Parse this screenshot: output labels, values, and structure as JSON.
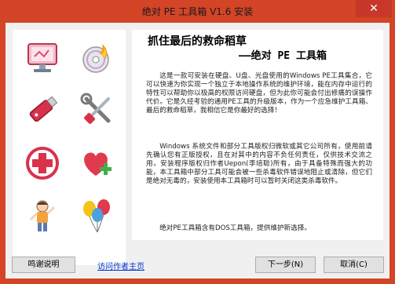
{
  "window": {
    "title": "绝对 PE 工具箱 V1.6 安装",
    "close_glyph": "✕"
  },
  "left_icons": [
    {
      "name": "computer-icon"
    },
    {
      "name": "disc-icon"
    },
    {
      "name": "usb-drive-icon"
    },
    {
      "name": "tools-icon"
    },
    {
      "name": "first-aid-icon"
    },
    {
      "name": "heart-plus-icon"
    },
    {
      "name": "child-figure-icon"
    },
    {
      "name": "balloons-icon"
    }
  ],
  "content": {
    "heading": "抓住最后的救命稻草",
    "subheading": "——绝对 PE 工具箱",
    "paragraphs": [
      "这是一款可安装在硬盘、U盘、光盘使用的Windows PE工具集合，它可以快速为你实现一个独立于本地操作系统的维护环境，能在内存中运行的特性可以帮助你以极高的权限访问硬盘，但为此你可能会付出修痛的误操作代价。它是久经考验的通用PE工具的升级版本，作为一个应急维护工具箱、最后的救命稻草，我相信它是你最好的选择！",
      "Windows 系统文件和部分工具版权归微软或其它公司所有，使用前请先确认您有正版授权，且在对其中的内容不负任何责任，仅供技术交流之用，安装程序版权归作者Uepon(李培聪)所有，由于具备特殊而强大的功能，本工具箱中部分工具可能会被一些杀毒软件错误地阻止或清除，但它们是绝对无毒的，安装使用本工具箱时可以暂时关闭这类杀毒软件。",
      "绝对PE工具箱含有DOS工具箱，提供维护新选择。"
    ]
  },
  "footer": {
    "thanks_label": "鸣谢说明",
    "author_link": "访问作者主页",
    "next_label": "下一步(N)",
    "cancel_label": "取消(C)"
  }
}
